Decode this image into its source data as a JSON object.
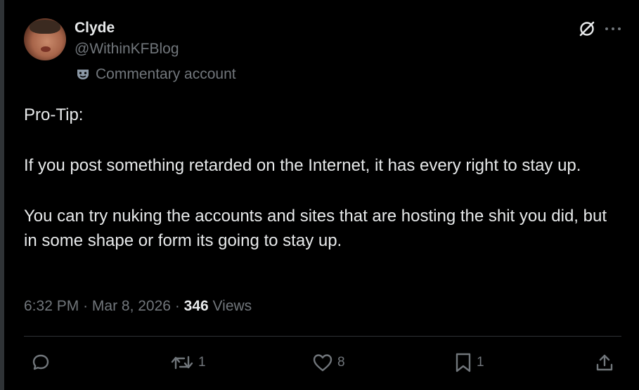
{
  "author": {
    "name": "Clyde",
    "handle": "@WithinKFBlog",
    "label": "Commentary account"
  },
  "tweet": {
    "lines": [
      "Pro-Tip:",
      "If you post something retarded on the Internet, it has every right to stay up.",
      "You can try nuking the accounts and sites that are hosting the shit you did, but in some shape or form its going to stay up."
    ],
    "time": "6:32 PM",
    "date": "Mar 8, 2026",
    "views": "346",
    "views_label": "Views"
  },
  "actions": {
    "reply_count": "",
    "repost_count": "1",
    "like_count": "8",
    "bookmark_count": "1"
  },
  "icons": {
    "grok": "grok-slash-icon",
    "more": "more-dots-icon",
    "badge": "theater-mask-icon",
    "reply": "reply-bubble-icon",
    "repost": "repost-icon",
    "like": "heart-icon",
    "bookmark": "bookmark-icon",
    "share": "share-icon"
  },
  "colors": {
    "background": "#000000",
    "text": "#e7e9ea",
    "muted": "#71767b",
    "divider": "#2f3336"
  }
}
